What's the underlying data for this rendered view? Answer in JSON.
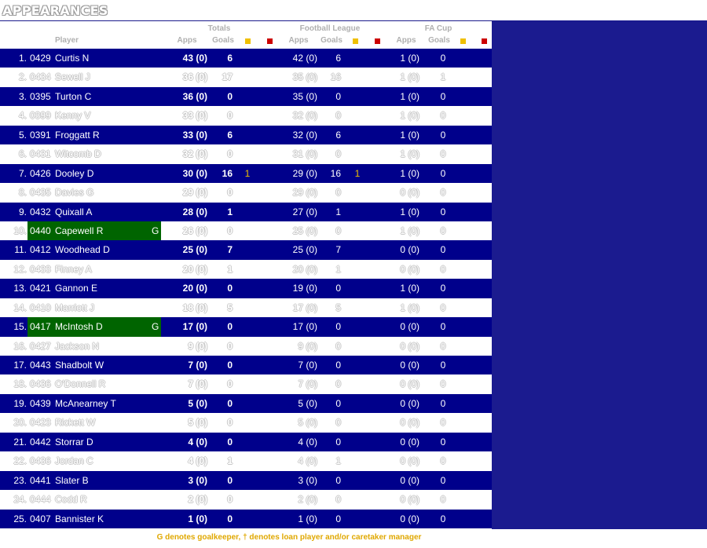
{
  "title": "APPEARANCES",
  "groups": {
    "totals": "Totals",
    "league": "Football League",
    "cup": "FA Cup"
  },
  "headers": {
    "player": "Player",
    "apps": "Apps",
    "goals": "Goals"
  },
  "colors": {
    "dark_row": "#00008b",
    "goalkeeper_highlight": "#006400",
    "yellow_card": "#f0c000",
    "red_card": "#cc0000"
  },
  "rows": [
    {
      "num": "1.",
      "code": "0429",
      "name": "Curtis N",
      "gk": "",
      "t_apps": "43 (0)",
      "t_goals": "6",
      "t_card": "",
      "l_apps": "42 (0)",
      "l_goals": "6",
      "l_card": "",
      "c_apps": "1 (0)",
      "c_goals": "0"
    },
    {
      "num": "2.",
      "code": "0434",
      "name": "Sewell J",
      "gk": "",
      "t_apps": "36 (0)",
      "t_goals": "17",
      "t_card": "",
      "l_apps": "35 (0)",
      "l_goals": "16",
      "l_card": "",
      "c_apps": "1 (0)",
      "c_goals": "1"
    },
    {
      "num": "3.",
      "code": "0395",
      "name": "Turton C",
      "gk": "",
      "t_apps": "36 (0)",
      "t_goals": "0",
      "t_card": "",
      "l_apps": "35 (0)",
      "l_goals": "0",
      "l_card": "",
      "c_apps": "1 (0)",
      "c_goals": "0"
    },
    {
      "num": "4.",
      "code": "0399",
      "name": "Kenny V",
      "gk": "",
      "t_apps": "33 (0)",
      "t_goals": "0",
      "t_card": "",
      "l_apps": "32 (0)",
      "l_goals": "0",
      "l_card": "",
      "c_apps": "1 (0)",
      "c_goals": "0"
    },
    {
      "num": "5.",
      "code": "0391",
      "name": "Froggatt R",
      "gk": "",
      "t_apps": "33 (0)",
      "t_goals": "6",
      "t_card": "",
      "l_apps": "32 (0)",
      "l_goals": "6",
      "l_card": "",
      "c_apps": "1 (0)",
      "c_goals": "0"
    },
    {
      "num": "6.",
      "code": "0431",
      "name": "Witcomb D",
      "gk": "",
      "t_apps": "32 (0)",
      "t_goals": "0",
      "t_card": "",
      "l_apps": "31 (0)",
      "l_goals": "0",
      "l_card": "",
      "c_apps": "1 (0)",
      "c_goals": "0"
    },
    {
      "num": "7.",
      "code": "0426",
      "name": "Dooley D",
      "gk": "",
      "t_apps": "30 (0)",
      "t_goals": "16",
      "t_card": "1",
      "l_apps": "29 (0)",
      "l_goals": "16",
      "l_card": "1",
      "c_apps": "1 (0)",
      "c_goals": "0"
    },
    {
      "num": "8.",
      "code": "0435",
      "name": "Davies G",
      "gk": "",
      "t_apps": "29 (0)",
      "t_goals": "0",
      "t_card": "",
      "l_apps": "29 (0)",
      "l_goals": "0",
      "l_card": "",
      "c_apps": "0 (0)",
      "c_goals": "0"
    },
    {
      "num": "9.",
      "code": "0432",
      "name": "Quixall A",
      "gk": "",
      "t_apps": "28 (0)",
      "t_goals": "1",
      "t_card": "",
      "l_apps": "27 (0)",
      "l_goals": "1",
      "l_card": "",
      "c_apps": "1 (0)",
      "c_goals": "0"
    },
    {
      "num": "10.",
      "code": "0440",
      "name": "Capewell R",
      "gk": "G",
      "t_apps": "26 (0)",
      "t_goals": "0",
      "t_card": "",
      "l_apps": "25 (0)",
      "l_goals": "0",
      "l_card": "",
      "c_apps": "1 (0)",
      "c_goals": "0"
    },
    {
      "num": "11.",
      "code": "0412",
      "name": "Woodhead D",
      "gk": "",
      "t_apps": "25 (0)",
      "t_goals": "7",
      "t_card": "",
      "l_apps": "25 (0)",
      "l_goals": "7",
      "l_card": "",
      "c_apps": "0 (0)",
      "c_goals": "0"
    },
    {
      "num": "12.",
      "code": "0433",
      "name": "Finney A",
      "gk": "",
      "t_apps": "20 (0)",
      "t_goals": "1",
      "t_card": "",
      "l_apps": "20 (0)",
      "l_goals": "1",
      "l_card": "",
      "c_apps": "0 (0)",
      "c_goals": "0"
    },
    {
      "num": "13.",
      "code": "0421",
      "name": "Gannon E",
      "gk": "",
      "t_apps": "20 (0)",
      "t_goals": "0",
      "t_card": "",
      "l_apps": "19 (0)",
      "l_goals": "0",
      "l_card": "",
      "c_apps": "1 (0)",
      "c_goals": "0"
    },
    {
      "num": "14.",
      "code": "0410",
      "name": "Marriott J",
      "gk": "",
      "t_apps": "18 (0)",
      "t_goals": "5",
      "t_card": "",
      "l_apps": "17 (0)",
      "l_goals": "5",
      "l_card": "",
      "c_apps": "1 (0)",
      "c_goals": "0"
    },
    {
      "num": "15.",
      "code": "0417",
      "name": "McIntosh D",
      "gk": "G",
      "t_apps": "17 (0)",
      "t_goals": "0",
      "t_card": "",
      "l_apps": "17 (0)",
      "l_goals": "0",
      "l_card": "",
      "c_apps": "0 (0)",
      "c_goals": "0"
    },
    {
      "num": "16.",
      "code": "0427",
      "name": "Jackson N",
      "gk": "",
      "t_apps": "9 (0)",
      "t_goals": "0",
      "t_card": "",
      "l_apps": "9 (0)",
      "l_goals": "0",
      "l_card": "",
      "c_apps": "0 (0)",
      "c_goals": "0"
    },
    {
      "num": "17.",
      "code": "0443",
      "name": "Shadbolt W",
      "gk": "",
      "t_apps": "7 (0)",
      "t_goals": "0",
      "t_card": "",
      "l_apps": "7 (0)",
      "l_goals": "0",
      "l_card": "",
      "c_apps": "0 (0)",
      "c_goals": "0"
    },
    {
      "num": "18.",
      "code": "0436",
      "name": "O'Donnell R",
      "gk": "",
      "t_apps": "7 (0)",
      "t_goals": "0",
      "t_card": "",
      "l_apps": "7 (0)",
      "l_goals": "0",
      "l_card": "",
      "c_apps": "0 (0)",
      "c_goals": "0"
    },
    {
      "num": "19.",
      "code": "0439",
      "name": "McAnearney T",
      "gk": "",
      "t_apps": "5 (0)",
      "t_goals": "0",
      "t_card": "",
      "l_apps": "5 (0)",
      "l_goals": "0",
      "l_card": "",
      "c_apps": "0 (0)",
      "c_goals": "0"
    },
    {
      "num": "20.",
      "code": "0423",
      "name": "Rickett W",
      "gk": "",
      "t_apps": "5 (0)",
      "t_goals": "0",
      "t_card": "",
      "l_apps": "5 (0)",
      "l_goals": "0",
      "l_card": "",
      "c_apps": "0 (0)",
      "c_goals": "0"
    },
    {
      "num": "21.",
      "code": "0442",
      "name": "Storrar D",
      "gk": "",
      "t_apps": "4 (0)",
      "t_goals": "0",
      "t_card": "",
      "l_apps": "4 (0)",
      "l_goals": "0",
      "l_card": "",
      "c_apps": "0 (0)",
      "c_goals": "0"
    },
    {
      "num": "22.",
      "code": "0436",
      "name": "Jordan C",
      "gk": "",
      "t_apps": "4 (0)",
      "t_goals": "1",
      "t_card": "",
      "l_apps": "4 (0)",
      "l_goals": "1",
      "l_card": "",
      "c_apps": "0 (0)",
      "c_goals": "0"
    },
    {
      "num": "23.",
      "code": "0441",
      "name": "Slater B",
      "gk": "",
      "t_apps": "3 (0)",
      "t_goals": "0",
      "t_card": "",
      "l_apps": "3 (0)",
      "l_goals": "0",
      "l_card": "",
      "c_apps": "0 (0)",
      "c_goals": "0"
    },
    {
      "num": "24.",
      "code": "0444",
      "name": "Codd R",
      "gk": "",
      "t_apps": "2 (0)",
      "t_goals": "0",
      "t_card": "",
      "l_apps": "2 (0)",
      "l_goals": "0",
      "l_card": "",
      "c_apps": "0 (0)",
      "c_goals": "0"
    },
    {
      "num": "25.",
      "code": "0407",
      "name": "Bannister K",
      "gk": "",
      "t_apps": "1 (0)",
      "t_goals": "0",
      "t_card": "",
      "l_apps": "1 (0)",
      "l_goals": "0",
      "l_card": "",
      "c_apps": "0 (0)",
      "c_goals": "0"
    }
  ],
  "footnote": "G denotes goalkeeper, † denotes loan player and/or caretaker manager"
}
